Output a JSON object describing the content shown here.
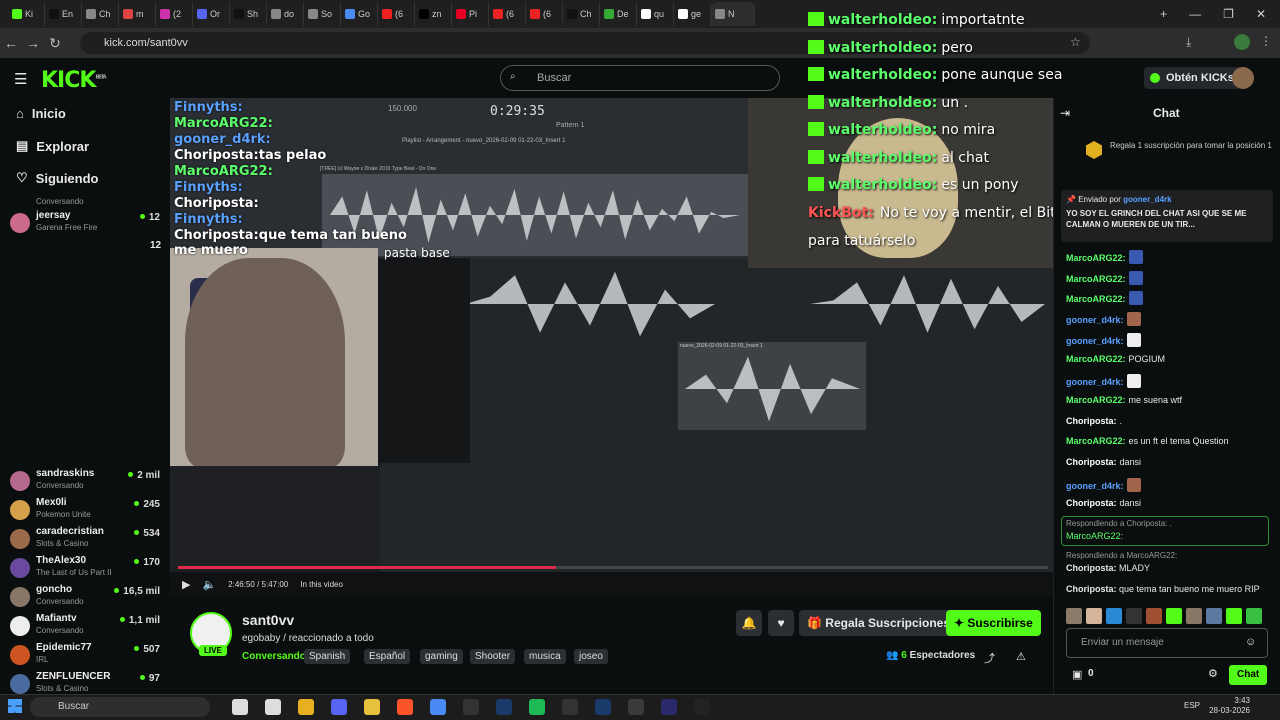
{
  "browser": {
    "tabs": [
      "Ki",
      "En",
      "Ch",
      "m",
      "(2",
      "Or",
      "Sh",
      "do",
      "So",
      "Go",
      "(6",
      "zn",
      "Pi",
      "(6",
      "(6",
      "Ch",
      "De",
      "qu",
      "ge",
      "N"
    ],
    "active_tab_index": 19,
    "url": "kick.com/sant0vv",
    "tab_icons": [
      "kick",
      "tiktok",
      "chatgpt",
      "gmail",
      "instagram",
      "discord",
      "tiktok",
      "chatgpt",
      "chatgpt",
      "google-docs",
      "youtube",
      "x",
      "pinterest",
      "youtube",
      "youtube",
      "tiktok",
      "drive",
      "google",
      "google",
      "chatgpt"
    ]
  },
  "header": {
    "logo": "KICK",
    "logo_sup": "BETA",
    "search_placeholder": "Buscar",
    "get_kicks": "Obtén KICKs"
  },
  "sidebar": {
    "nav": [
      {
        "label": "Inicio",
        "icon": "home-icon"
      },
      {
        "label": "Explorar",
        "icon": "compass-icon"
      },
      {
        "label": "Siguiendo",
        "icon": "heart-icon"
      }
    ],
    "channels_top": [
      {
        "category": "Conversando"
      },
      {
        "name": "jeersay",
        "category": "Garena Free Fire",
        "viewers": "12"
      },
      {
        "viewers": "12"
      }
    ],
    "channels": [
      {
        "name": "sandraskins",
        "category": "Conversando",
        "viewers": "2 mil",
        "color": "#b36a8c"
      },
      {
        "name": "Mex0li",
        "category": "Pokemon Unite",
        "viewers": "245",
        "color": "#d4a04a"
      },
      {
        "name": "caradecristian",
        "category": "Slots & Casino",
        "viewers": "534",
        "color": "#9a6a4a"
      },
      {
        "name": "TheAlex30",
        "category": "The Last of Us Part II",
        "viewers": "170",
        "color": "#6a4aa0"
      },
      {
        "name": "goncho",
        "category": "Conversando",
        "viewers": "16,5 mil",
        "color": "#887766"
      },
      {
        "name": "Mafiantv",
        "category": "Conversando",
        "viewers": "1,1 mil",
        "color": "#eeeeee"
      },
      {
        "name": "Epidemic77",
        "category": "IRL",
        "viewers": "507",
        "color": "#cc5522"
      },
      {
        "name": "ZENFLUENCER",
        "category": "Slots & Casino",
        "viewers": "97",
        "color": "#4a6aa0"
      }
    ]
  },
  "video": {
    "overlay_chat": [
      {
        "user": "Finnyths:",
        "text": "",
        "color": "#5aa0ff"
      },
      {
        "user": "MarcoARG22:",
        "text": "",
        "color": "#5cff6b"
      },
      {
        "user": "gooner_d4rk:",
        "text": "",
        "color": "#5aa0ff"
      },
      {
        "user": "Choriposta:",
        "text": "tas pelao",
        "color": "#ffffff"
      },
      {
        "user": "MarcoARG22:",
        "text": "",
        "color": "#5cff6b"
      },
      {
        "user": "Finnyths:",
        "text": "",
        "color": "#5aa0ff"
      },
      {
        "user": "Choriposta:",
        "text": "",
        "color": "#ffffff"
      },
      {
        "user": "Finnyths:",
        "text": "",
        "color": "#5aa0ff"
      },
      {
        "user": "Choriposta:",
        "text": "que tema tan bueno me muero",
        "color": "#ffffff"
      }
    ],
    "overlay_extra": "pasta base",
    "big_chat": [
      {
        "user": "walterholdeo:",
        "text": "importatnte"
      },
      {
        "user": "walterholdeo:",
        "text": "pero"
      },
      {
        "user": "walterholdeo:",
        "text": "pone aunque sea"
      },
      {
        "user": "walterholdeo:",
        "text": "un ."
      },
      {
        "user": "walterholdeo:",
        "text": "no mira"
      },
      {
        "user": "walterholdeo:",
        "text": "al chat"
      },
      {
        "user": "walterholdeo:",
        "text": "es un pony"
      }
    ],
    "bot_line": {
      "user": "KickBot:",
      "text": "No te voy a mentir, el Bitcoin está"
    },
    "bot_line2": "para tatuárselo",
    "daw_time": "0:29:35",
    "daw_bpm": "150.000",
    "daw_pattern": "Pattern 1",
    "daw_playlist": "Playlist - Arrangement - nuevo_2026-02-09 01-22-03_Insert 1",
    "daw_clip": "[TREE] Lil Wayne x Drake 2010 Type Beat - On One",
    "daw_clip2": "nuevo_2026-02-09 01-22-03_Insert 1",
    "controls": {
      "time": "2:46:50 / 5:47:00",
      "in_video": "In this video"
    },
    "progress_fraction": 0.435
  },
  "channel": {
    "name": "sant0vv",
    "live": "LIVE",
    "title": "egobaby / reaccionado a todo",
    "category": "Conversando",
    "tags": [
      "Spanish",
      "Español",
      "gaming",
      "Shooter",
      "musica",
      "joseo"
    ],
    "gift_label": "Regala Suscripciones",
    "subscribe_label": "Suscribirse",
    "viewers": "6",
    "viewers_label": "Espectadores"
  },
  "chat": {
    "title": "Chat",
    "sub_goal": "Regala 1 suscripción para tomar la posición 1",
    "pinned_by": "Enviado por",
    "pinned_user": "gooner_d4rk",
    "pinned_text": "YO SOY EL GRINCH DEL CHAT ASI QUE SE ME CALMAN O MUEREN DE UN TIR...",
    "messages": [
      {
        "user": "MarcoARG22:",
        "text": "",
        "color": "#5cff6b",
        "emote": "#3a5ab0"
      },
      {
        "user": "MarcoARG22:",
        "text": "",
        "color": "#5cff6b",
        "emote": "#3a5ab0"
      },
      {
        "user": "MarcoARG22:",
        "text": "",
        "color": "#5cff6b",
        "emote": "#3a5ab0"
      },
      {
        "user": "gooner_d4rk:",
        "text": "",
        "color": "#5aa0ff",
        "emote": "#a0654a"
      },
      {
        "user": "gooner_d4rk:",
        "text": "",
        "color": "#5aa0ff",
        "emote": "#eeeeee"
      },
      {
        "user": "MarcoARG22:",
        "text": "POGIUM",
        "color": "#5cff6b",
        "emote": ""
      },
      {
        "user": "gooner_d4rk:",
        "text": "",
        "color": "#5aa0ff",
        "emote": "#eeeeee"
      },
      {
        "user": "MarcoARG22:",
        "text": "me suena wtf",
        "color": "#5cff6b",
        "emote": ""
      },
      {
        "user": "Choriposta:",
        "text": ".",
        "color": "#ffffff",
        "emote": ""
      },
      {
        "user": "MarcoARG22:",
        "text": "es un ft el tema Question",
        "color": "#5cff6b",
        "emote": ""
      },
      {
        "user": "Choriposta:",
        "text": "dansi",
        "color": "#ffffff",
        "emote": ""
      },
      {
        "user": "gooner_d4rk:",
        "text": "",
        "color": "#5aa0ff",
        "emote": "#a0654a"
      },
      {
        "user": "Choriposta:",
        "text": "dansi",
        "color": "#ffffff",
        "emote": ""
      }
    ],
    "reply1_label": "Respondiendo a Choriposta: .",
    "reply1_user": "MarcoARG22:",
    "reply2_label": "Respondiendo a MarcoARG22:",
    "reply2_user": "Choriposta:",
    "reply2_text": "MLADY",
    "last_user": "Choriposta:",
    "last_text": "que tema tan bueno me muero RIP",
    "input_placeholder": "Enviar un mensaje",
    "points": "0",
    "send_label": "Chat"
  },
  "taskbar": {
    "search": "Buscar",
    "lang": "ESP",
    "time": "3:43",
    "date": "28-03-2026"
  }
}
